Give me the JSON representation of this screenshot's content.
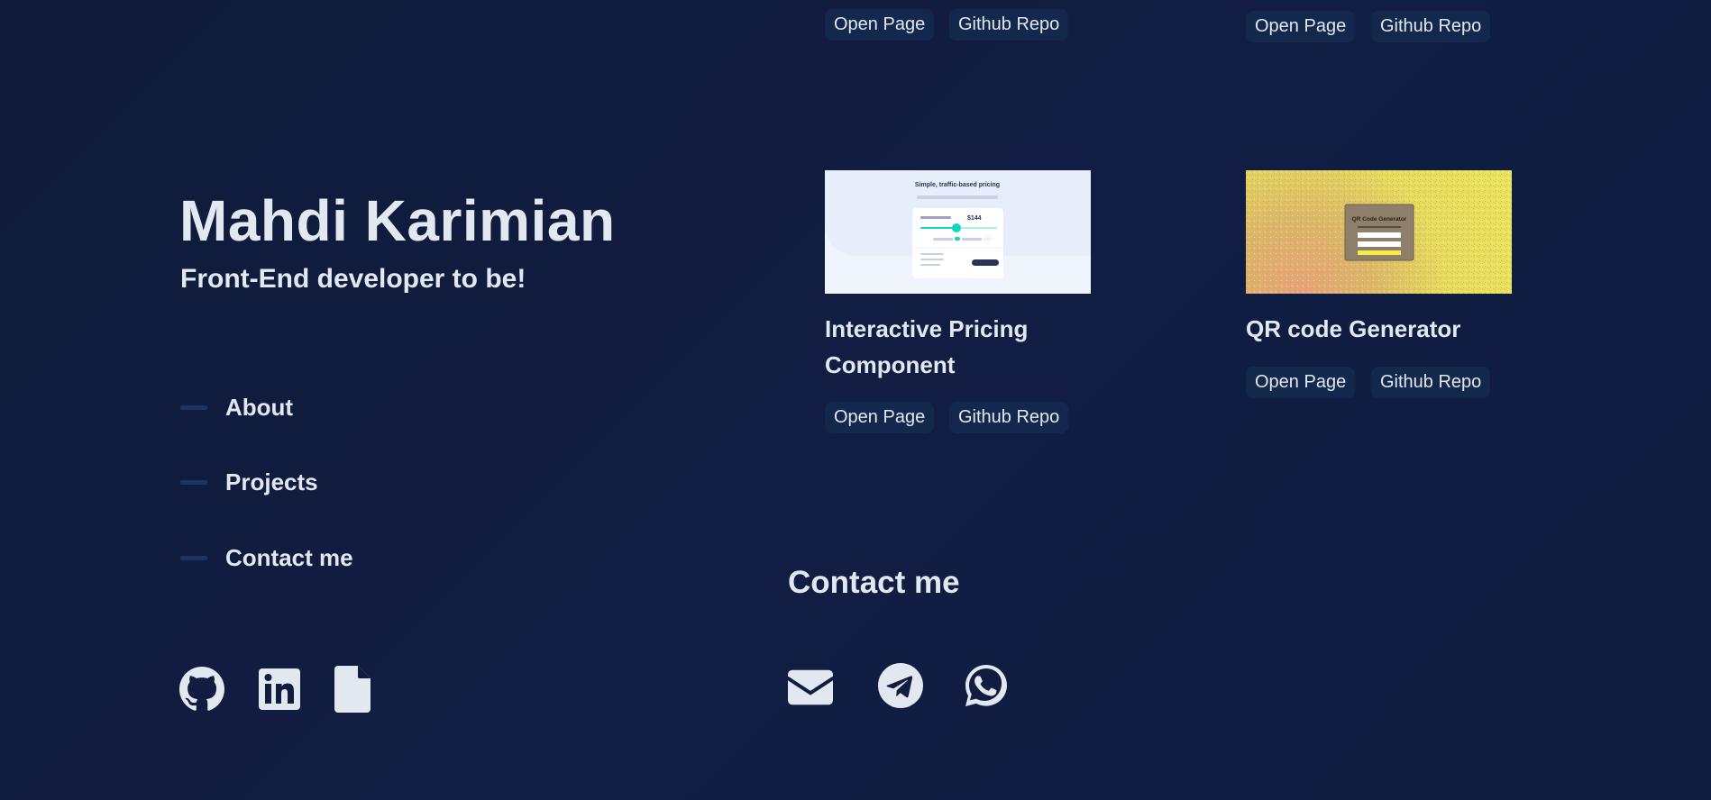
{
  "profile": {
    "name": "Mahdi Karimian",
    "tagline": "Front-End developer to be!"
  },
  "nav": {
    "items": [
      {
        "label": "About"
      },
      {
        "label": "Projects"
      },
      {
        "label": "Contact me"
      }
    ]
  },
  "social_links": [
    {
      "icon": "github-icon"
    },
    {
      "icon": "linkedin-icon"
    },
    {
      "icon": "resume-file-icon"
    }
  ],
  "projects": [
    {
      "title": "",
      "open_label": "Open Page",
      "repo_label": "Github Repo"
    },
    {
      "title": "",
      "open_label": "Open Page",
      "repo_label": "Github Repo"
    },
    {
      "title": "Interactive Pricing Component",
      "open_label": "Open Page",
      "repo_label": "Github Repo",
      "thumbnail": {
        "heading": "Simple, traffic-based pricing",
        "price": "$144",
        "accent": "#10d5c2"
      }
    },
    {
      "title": "QR code Generator",
      "open_label": "Open Page",
      "repo_label": "Github Repo",
      "thumbnail": {
        "heading": "QR Code Generator",
        "accent": "#f5ed42"
      }
    }
  ],
  "contact": {
    "heading": "Contact me",
    "icons": [
      "email-icon",
      "telegram-icon",
      "whatsapp-icon"
    ]
  },
  "colors": {
    "background": "#111d40",
    "text": "#e2e8f0",
    "pill_bg": "#13284c",
    "nav_dash": "#1a3560"
  }
}
